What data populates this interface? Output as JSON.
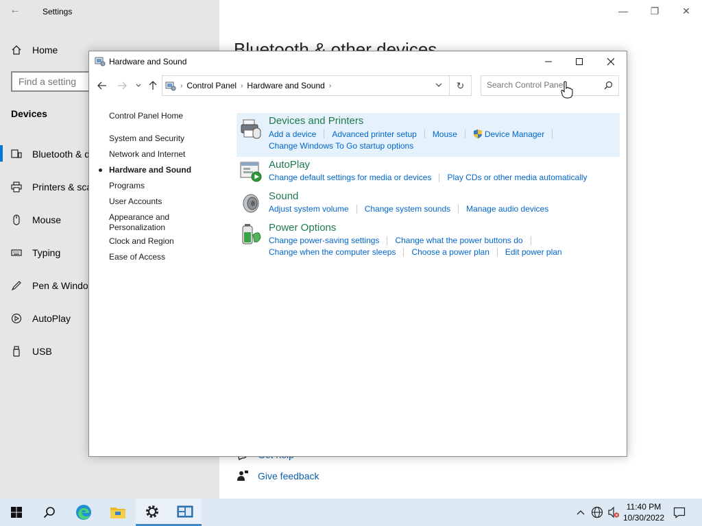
{
  "settings": {
    "title": "Settings",
    "home": "Home",
    "search_placeholder": "Find a setting",
    "section": "Devices",
    "nav": [
      {
        "label": "Bluetooth & devices",
        "icon": "bluetooth-icon"
      },
      {
        "label": "Printers & scanners",
        "icon": "printer-icon"
      },
      {
        "label": "Mouse",
        "icon": "mouse-icon"
      },
      {
        "label": "Typing",
        "icon": "keyboard-icon"
      },
      {
        "label": "Pen & Windows Ink",
        "icon": "pen-icon"
      },
      {
        "label": "AutoPlay",
        "icon": "autoplay-icon"
      },
      {
        "label": "USB",
        "icon": "usb-icon"
      }
    ],
    "main_heading": "Bluetooth & other devices",
    "get_help": "Get help",
    "give_feedback": "Give feedback"
  },
  "cp": {
    "title": "Hardware and Sound",
    "breadcrumb": [
      "Control Panel",
      "Hardware and Sound"
    ],
    "search_placeholder": "Search Control Panel",
    "sidebar": {
      "home": "Control Panel Home",
      "items": [
        {
          "label": "System and Security"
        },
        {
          "label": "Network and Internet"
        },
        {
          "label": "Hardware and Sound",
          "current": true
        },
        {
          "label": "Programs"
        },
        {
          "label": "User Accounts"
        },
        {
          "label": "Appearance and"
        },
        {
          "label": "Personalization"
        },
        {
          "label": "Clock and Region"
        },
        {
          "label": "Ease of Access"
        }
      ]
    },
    "categories": [
      {
        "title": "Devices and Printers",
        "icon": "devices-printers-icon",
        "links": [
          [
            "Add a device",
            "Advanced printer setup",
            "Mouse",
            "Device Manager"
          ],
          [
            "Change Windows To Go startup options"
          ]
        ]
      },
      {
        "title": "AutoPlay",
        "icon": "autoplay-icon",
        "links": [
          [
            "Change default settings for media or devices",
            "Play CDs or other media automatically"
          ]
        ]
      },
      {
        "title": "Sound",
        "icon": "speaker-icon",
        "links": [
          [
            "Adjust system volume",
            "Change system sounds",
            "Manage audio devices"
          ]
        ]
      },
      {
        "title": "Power Options",
        "icon": "battery-icon",
        "links": [
          [
            "Change power-saving settings",
            "Change what the power buttons do"
          ],
          [
            "Change when the computer sleeps",
            "Choose a power plan",
            "Edit power plan"
          ]
        ]
      }
    ]
  },
  "taskbar": {
    "time": "11:40 PM",
    "date": "10/30/2022"
  }
}
